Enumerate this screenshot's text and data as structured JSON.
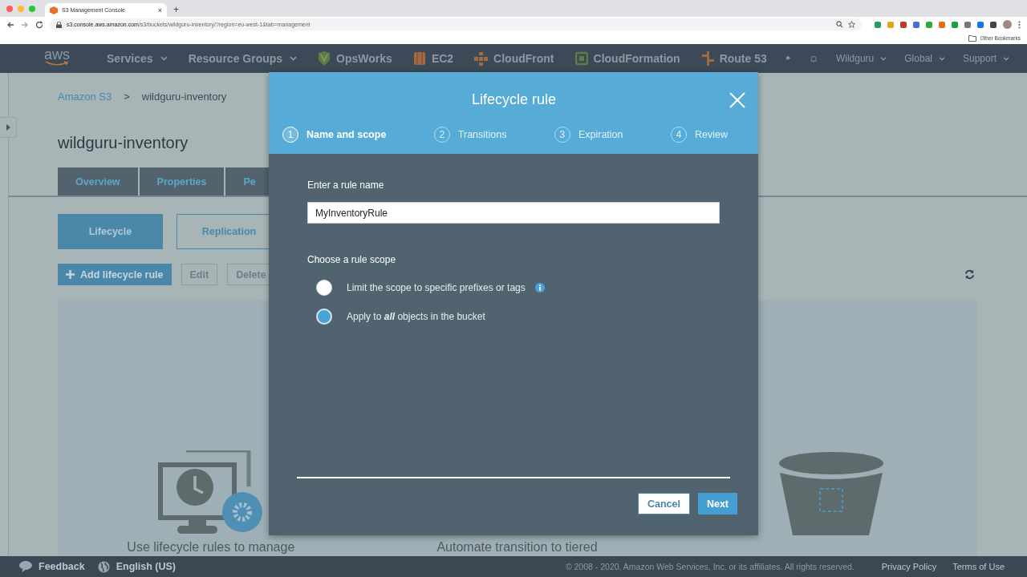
{
  "browser": {
    "tab_title": "S3 Management Console",
    "tab_close": "×",
    "new_tab": "+",
    "url_host": "s3.console.aws.amazon.com",
    "url_path": "/s3/buckets/wildguru-inventory/?region=eu-west-1&tab=management",
    "bookmarks": "Other Bookmarks"
  },
  "navbar": {
    "logo": "aws",
    "menus": [
      {
        "label": "Services"
      },
      {
        "label": "Resource Groups"
      }
    ],
    "shortcuts": [
      {
        "label": "OpsWorks",
        "kind": "shield"
      },
      {
        "label": "EC2",
        "kind": "cube"
      },
      {
        "label": "CloudFront",
        "kind": "grid"
      },
      {
        "label": "CloudFormation",
        "kind": "square"
      },
      {
        "label": "Route 53",
        "kind": "signpost"
      }
    ],
    "account_menus": [
      {
        "label": "Wildguru"
      },
      {
        "label": "Global"
      },
      {
        "label": "Support"
      }
    ]
  },
  "breadcrumb": [
    {
      "label": "Amazon S3",
      "link": true
    },
    {
      "label": "wildguru-inventory",
      "link": false
    }
  ],
  "breadcrumb_separator": ">",
  "bucket_title": "wildguru-inventory",
  "tabs": [
    {
      "label": "Overview",
      "selected": false
    },
    {
      "label": "Properties",
      "selected": false
    },
    {
      "label": "Pe",
      "selected": false
    }
  ],
  "subtabs": [
    {
      "label": "Lifecycle",
      "selected": true
    },
    {
      "label": "Replication",
      "selected": false
    }
  ],
  "actions": [
    {
      "label": "Add lifecycle rule",
      "disabled": false,
      "kind": "add"
    },
    {
      "label": "Edit",
      "disabled": true,
      "kind": "plain"
    },
    {
      "label": "Delete",
      "disabled": true,
      "kind": "plain"
    }
  ],
  "panel_texts": [
    "Use lifecycle rules to manage",
    "Automate transition to tiered"
  ],
  "modal": {
    "title": "Lifecycle rule",
    "steps": [
      {
        "number": "1",
        "label": "Name and scope",
        "selected": true
      },
      {
        "number": "2",
        "label": "Transitions",
        "selected": false
      },
      {
        "number": "3",
        "label": "Expiration",
        "selected": false
      },
      {
        "number": "4",
        "label": "Review",
        "selected": false
      }
    ],
    "name_label": "Enter a rule name",
    "name_value": "MyInventoryRule",
    "scope_label": "Choose a rule scope",
    "scopes": [
      {
        "label": "Limit the scope to specific prefixes or tags",
        "selected": false,
        "info": true
      },
      {
        "label": "Apply to **all** objects in the bucket",
        "selected": true,
        "info": false
      }
    ],
    "buttons": [
      {
        "label": "Cancel",
        "kind": "secondary"
      },
      {
        "label": "Next",
        "kind": "primary"
      }
    ]
  },
  "footer": {
    "feedback": "Feedback",
    "language": "English (US)",
    "copyright": "© 2008 - 2020, Amazon Web Services, Inc. or its affiliates. All rights reserved.",
    "links": [
      "Privacy Policy",
      "Terms of Use"
    ]
  }
}
